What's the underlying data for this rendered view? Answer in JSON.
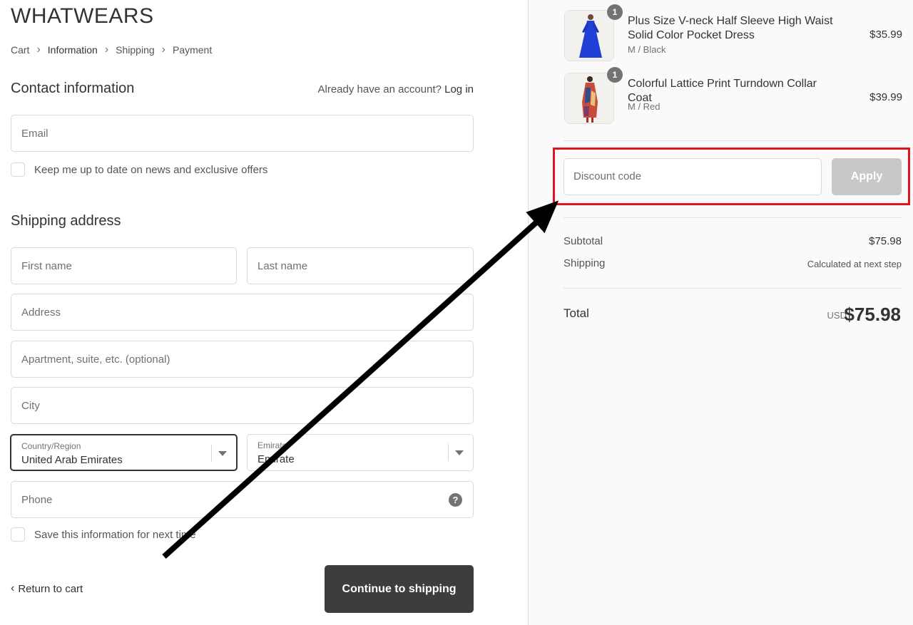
{
  "brand": "WHATWEARS",
  "breadcrumb": {
    "items": [
      "Cart",
      "Information",
      "Shipping",
      "Payment"
    ],
    "active": "Information"
  },
  "contact": {
    "heading": "Contact information",
    "login_prompt": "Already have an account?",
    "login_link": "Log in",
    "email_placeholder": "Email",
    "newsletter_label": "Keep me up to date on news and exclusive offers"
  },
  "shipping": {
    "heading": "Shipping address",
    "first_name_placeholder": "First name",
    "last_name_placeholder": "Last name",
    "address_placeholder": "Address",
    "apartment_placeholder": "Apartment, suite, etc. (optional)",
    "city_placeholder": "City",
    "country_label": "Country/Region",
    "country_value": "United Arab Emirates",
    "emirate_label": "Emirate",
    "emirate_value": "Emirate",
    "phone_placeholder": "Phone",
    "save_info_label": "Save this information for next time"
  },
  "actions": {
    "return_label": "Return to cart",
    "continue_label": "Continue to shipping"
  },
  "order": {
    "items": [
      {
        "qty": "1",
        "name": "Plus Size V-neck Half Sleeve High Waist Solid Color Pocket Dress",
        "variant": "M / Black",
        "price": "$35.99"
      },
      {
        "qty": "1",
        "name": "Colorful Lattice Print Turndown Collar Coat",
        "variant": "M / Red",
        "price": "$39.99"
      }
    ],
    "discount_placeholder": "Discount code",
    "apply_label": "Apply",
    "subtotal_label": "Subtotal",
    "subtotal_value": "$75.98",
    "shipping_label": "Shipping",
    "shipping_value": "Calculated at next step",
    "total_label": "Total",
    "currency": "USD",
    "total_value": "$75.98"
  },
  "colors": {
    "highlight": "#e0141e",
    "button_dark": "#3d3d3d",
    "button_disabled": "#c8c8c8",
    "sidebar_bg": "#fafafa"
  }
}
